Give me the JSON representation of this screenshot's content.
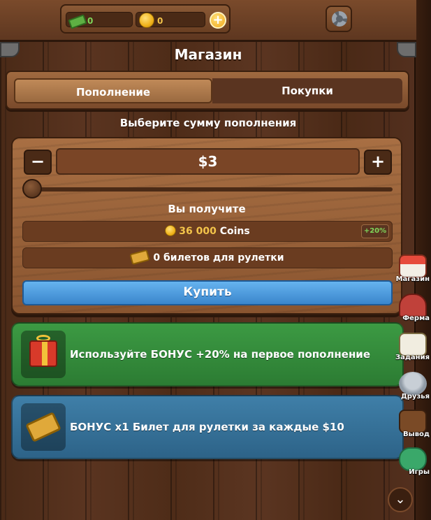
{
  "topbar": {
    "cash_value": "0",
    "coins_value": "0",
    "add_icon": "plus-icon",
    "settings_icon": "gear-icon"
  },
  "title": "Магазин",
  "tabs": [
    {
      "label": "Пополнение",
      "active": true
    },
    {
      "label": "Покупки",
      "active": false
    }
  ],
  "subtitle": "Выберите сумму пополнения",
  "amount": {
    "minus_label": "−",
    "plus_label": "+",
    "value": "$3",
    "slider_fraction": 0.0
  },
  "receive": {
    "label": "Вы получите",
    "coins_amount": "36 000",
    "coins_unit": "Coins",
    "bonus": "+20%",
    "tickets": "0 билетов для рулетки"
  },
  "buy_label": "Купить",
  "banners": [
    {
      "text": "Используйте БОНУС +20% на первое пополнение",
      "icon": "gift-icon",
      "color": "#3c9a43"
    },
    {
      "text": "БОНУС x1 Билет для рулетки за каждые $10",
      "icon": "ticket-icon",
      "color": "#3f7fa8"
    }
  ],
  "side_nav": [
    {
      "label": "Магазин",
      "icon": "shop-icon"
    },
    {
      "label": "Ферма",
      "icon": "farm-icon"
    },
    {
      "label": "Задания",
      "icon": "tasks-icon"
    },
    {
      "label": "Друзья",
      "icon": "friends-icon"
    },
    {
      "label": "Вывод",
      "icon": "wallet-icon"
    },
    {
      "label": "Игры",
      "icon": "gamepad-icon"
    }
  ],
  "scroll_icon": "chevron-down-icon"
}
